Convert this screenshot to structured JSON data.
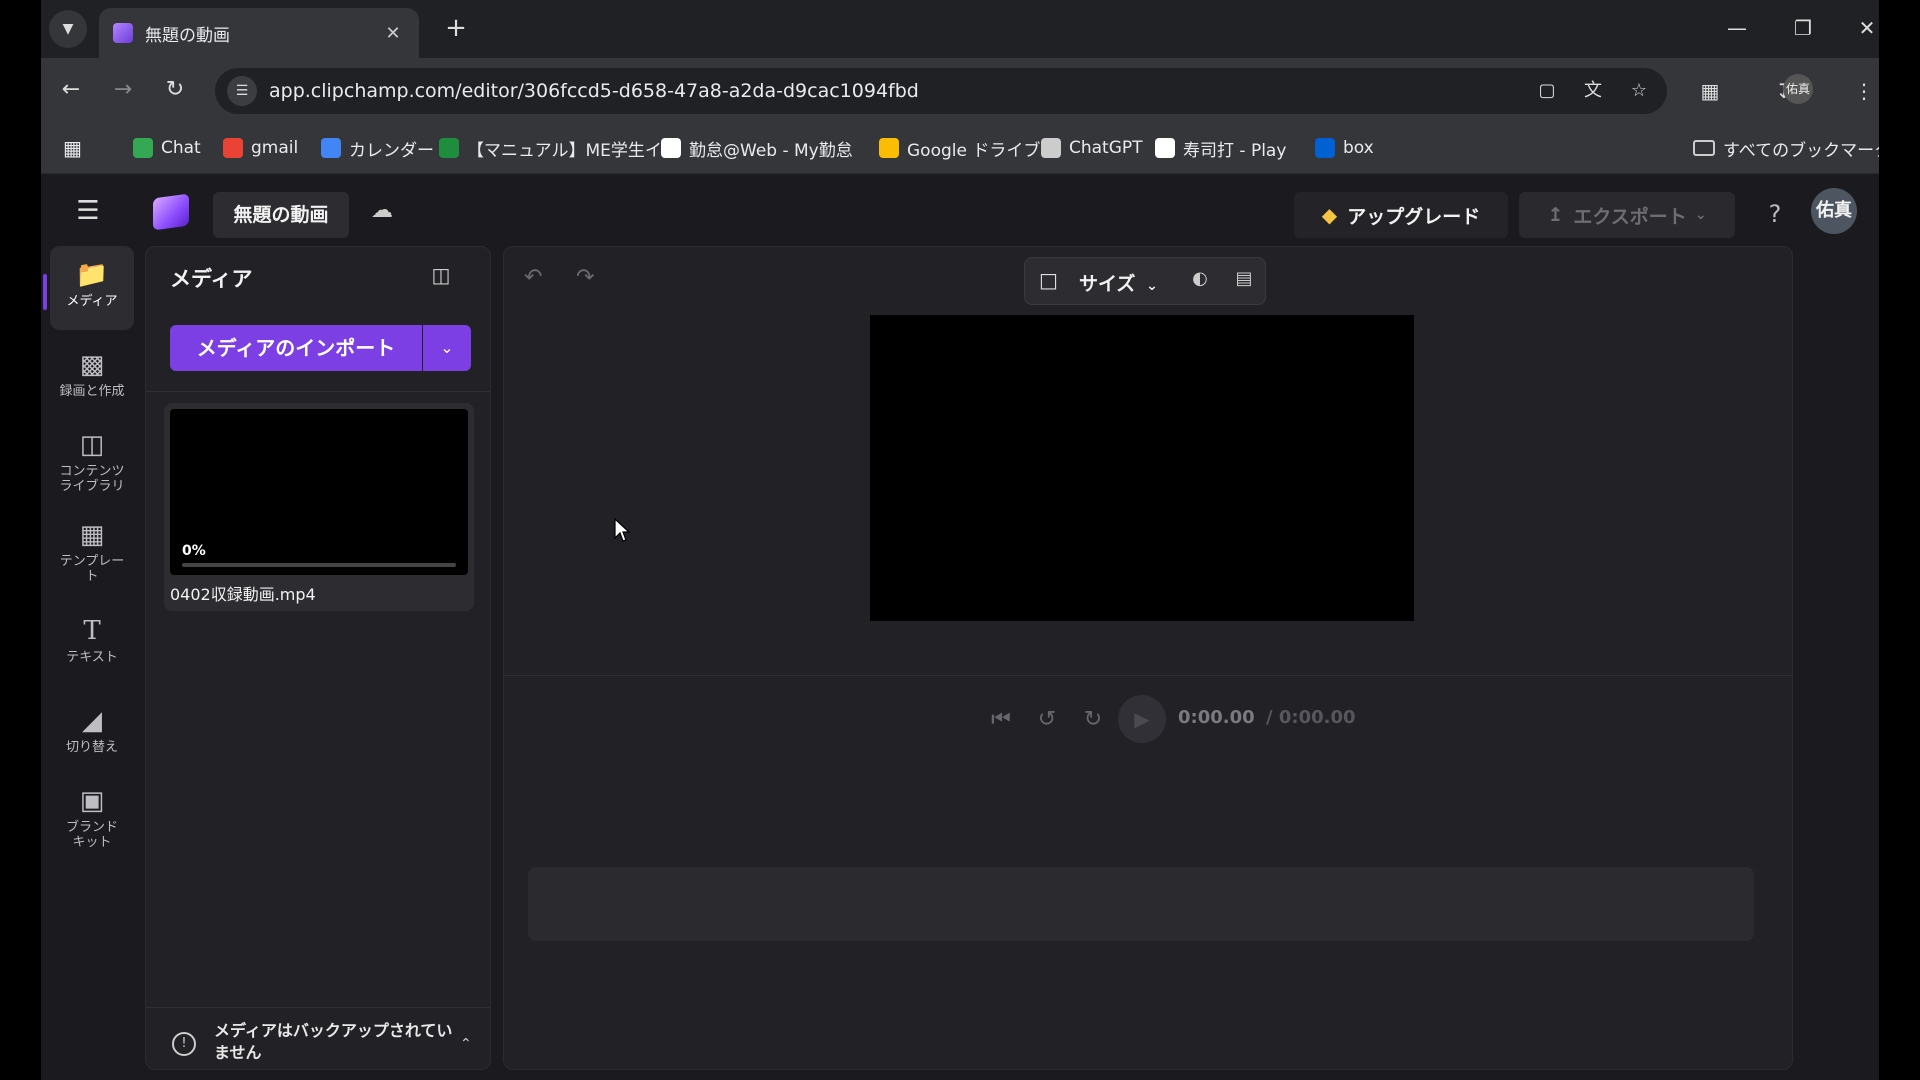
{
  "browser": {
    "tab_title": "無題の動画",
    "url": "app.clipchamp.com/editor/306fccd5-d658-47a8-a2da-d9cac1094fbd",
    "bookmarks": [
      {
        "label": "Chat",
        "color": "#34a853"
      },
      {
        "label": "gmail",
        "color": "#ea4335"
      },
      {
        "label": "カレンダー",
        "color": "#4285f4"
      },
      {
        "label": "【マニュアル】ME学生イ...",
        "color": "#1e8e3e"
      },
      {
        "label": "勤怠@Web - My勤怠",
        "color": "#ffffff"
      },
      {
        "label": "Google ドライブ",
        "color": "#fbbc04"
      },
      {
        "label": "ChatGPT",
        "color": "#cccccc"
      },
      {
        "label": "寿司打 - Play",
        "color": "#ffffff"
      },
      {
        "label": "box",
        "color": "#0061d5"
      }
    ],
    "all_bookmarks": "すべてのブックマーク",
    "profile_initials": "佑真"
  },
  "app": {
    "project_title": "無題の動画",
    "upgrade_label": "アップグレード",
    "export_label": "エクスポート",
    "help_label": "?",
    "avatar_initials": "佑真",
    "accent_color": "#7b3fe4"
  },
  "rail": {
    "items": [
      {
        "label": "メディア",
        "icon": "folder-icon"
      },
      {
        "label": "録画と作成",
        "icon": "camera-icon"
      },
      {
        "label": "コンテンツ\nライブラリ",
        "icon": "library-icon"
      },
      {
        "label": "テンプレー\nト",
        "icon": "templates-icon"
      },
      {
        "label": "テキスト",
        "icon": "text-icon"
      },
      {
        "label": "切り替え",
        "icon": "transitions-icon"
      },
      {
        "label": "ブランド\nキット",
        "icon": "brand-kit-icon"
      }
    ]
  },
  "media": {
    "title": "メディア",
    "import_label": "メディアのインポート",
    "items": [
      {
        "name": "0402収録動画.mp4",
        "progress_text": "0%",
        "progress": 0
      }
    ],
    "backup_note": "メディアはバックアップされていません"
  },
  "preview": {
    "size_label": "サイズ",
    "time_current": "0:00.00",
    "time_total": "/ 0:00.00"
  }
}
